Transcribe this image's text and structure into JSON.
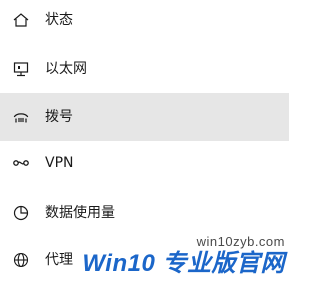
{
  "nav": {
    "items": [
      {
        "label": "状态",
        "icon": "home-icon",
        "selected": false
      },
      {
        "label": "以太网",
        "icon": "ethernet-icon",
        "selected": false
      },
      {
        "label": "拨号",
        "icon": "dial-up-icon",
        "selected": true
      },
      {
        "label": "VPN",
        "icon": "vpn-icon",
        "selected": false
      },
      {
        "label": "数据使用量",
        "icon": "data-usage-icon",
        "selected": false
      },
      {
        "label": "代理",
        "icon": "globe-icon",
        "selected": false
      }
    ]
  },
  "watermark": {
    "url": "win10zyb.com",
    "brand": "Win10 专业版官网"
  },
  "colors": {
    "selected_bg": "#e6e6e6",
    "text": "#1a1a1a",
    "watermark_brand": "#1b66c9"
  }
}
